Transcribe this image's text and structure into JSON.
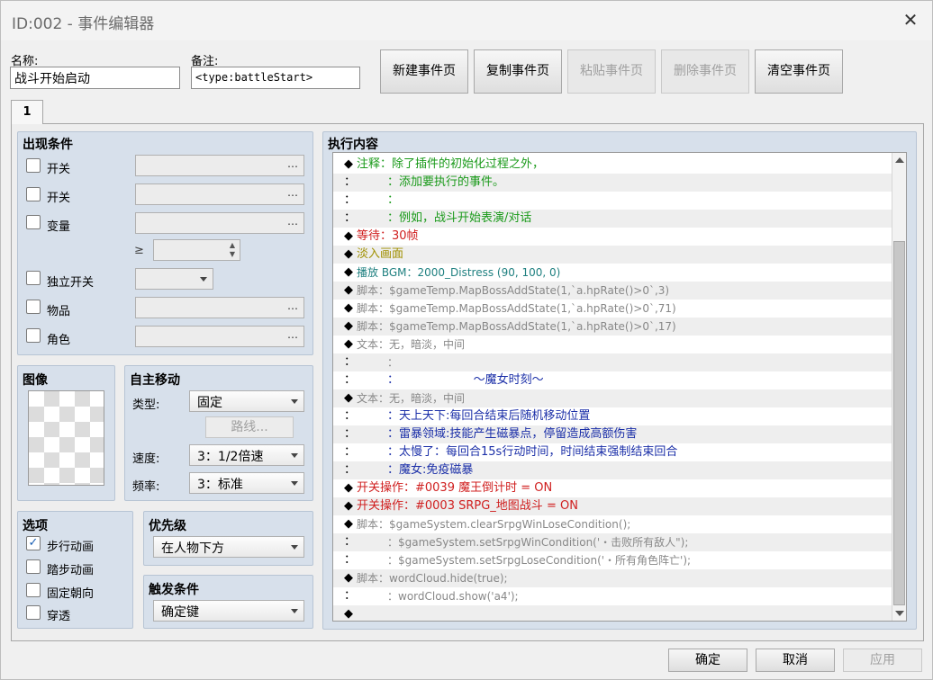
{
  "window": {
    "title": "ID:002 - 事件编辑器"
  },
  "name_label": "名称:",
  "name_value": "战斗开始启动",
  "note_label": "备注:",
  "note_value": "<type:battleStart>",
  "page_buttons": [
    "新建事件页",
    "复制事件页",
    "粘贴事件页",
    "删除事件页",
    "清空事件页"
  ],
  "tab_label": "1",
  "conditions": {
    "title": "出现条件",
    "items": [
      "开关",
      "开关",
      "变量",
      "独立开关",
      "物品",
      "角色"
    ],
    "dots": "…",
    "gte": "≥"
  },
  "image": {
    "title": "图像"
  },
  "autonomous": {
    "title": "自主移动",
    "type_label": "类型:",
    "type_value": "固定",
    "route_button": "路线...",
    "speed_label": "速度:",
    "speed_value": "3：1/2倍速",
    "freq_label": "频率:",
    "freq_value": "3：标准"
  },
  "options": {
    "title": "选项",
    "items": [
      {
        "label": "步行动画",
        "checked": true
      },
      {
        "label": "踏步动画",
        "checked": false
      },
      {
        "label": "固定朝向",
        "checked": false
      },
      {
        "label": "穿透",
        "checked": false
      }
    ],
    "check_mark": "✓"
  },
  "priority": {
    "title": "优先级",
    "value": "在人物下方"
  },
  "trigger": {
    "title": "触发条件",
    "value": "确定键"
  },
  "content": {
    "title": "执行内容",
    "rows": [
      {
        "m": "◆",
        "t": "注释：除了插件的初始化过程之外，",
        "c": "green"
      },
      {
        "m": "：",
        "t": "：添加要执行的事件。",
        "c": "green",
        "i": true
      },
      {
        "m": "：",
        "t": "：",
        "c": "green",
        "i": true
      },
      {
        "m": "：",
        "t": "：例如，战斗开始表演/对话",
        "c": "green",
        "i": true
      },
      {
        "m": "◆",
        "t": "等待：30帧",
        "c": "red"
      },
      {
        "m": "◆",
        "t": "淡入画面",
        "c": "olive"
      },
      {
        "m": "◆",
        "t": "播放 BGM：2000_Distress (90, 100, 0)",
        "c": "teal"
      },
      {
        "m": "◆",
        "t": "脚本：$gameTemp.MapBossAddState(1,`a.hpRate()>0`,3)",
        "c": "gray"
      },
      {
        "m": "◆",
        "t": "脚本：$gameTemp.MapBossAddState(1,`a.hpRate()>0`,71)",
        "c": "gray"
      },
      {
        "m": "◆",
        "t": "脚本：$gameTemp.MapBossAddState(1,`a.hpRate()>0`,17)",
        "c": "gray"
      },
      {
        "m": "◆",
        "t": "文本：无，暗淡，中间",
        "c": "gray"
      },
      {
        "m": "：",
        "t": "：",
        "c": "gray",
        "i": true
      },
      {
        "m": "：",
        "t": "：                    ～魔女时刻～",
        "c": "blue",
        "i": true
      },
      {
        "m": "◆",
        "t": "文本：无，暗淡，中间",
        "c": "gray"
      },
      {
        "m": "：",
        "t": "：天上天下:每回合结束后随机移动位置",
        "c": "blue",
        "i": true
      },
      {
        "m": "：",
        "t": "：雷暴领域:技能产生磁暴点，停留造成高额伤害",
        "c": "blue",
        "i": true
      },
      {
        "m": "：",
        "t": "：太慢了：每回合15s行动时间，时间结束强制结束回合",
        "c": "blue",
        "i": true
      },
      {
        "m": "：",
        "t": "：魔女:免疫磁暴",
        "c": "blue",
        "i": true
      },
      {
        "m": "◆",
        "t": "开关操作：#0039 魔王倒计时 = ON",
        "c": "red"
      },
      {
        "m": "◆",
        "t": "开关操作：#0003 SRPG_地图战斗 = ON",
        "c": "red"
      },
      {
        "m": "◆",
        "t": "脚本：$gameSystem.clearSrpgWinLoseCondition();",
        "c": "gray"
      },
      {
        "m": "：",
        "t": "：$gameSystem.setSrpgWinCondition('・击败所有敌人\");",
        "c": "gray",
        "i": true
      },
      {
        "m": "：",
        "t": "：$gameSystem.setSrpgLoseCondition('・所有角色阵亡');",
        "c": "gray",
        "i": true
      },
      {
        "m": "◆",
        "t": "脚本：wordCloud.hide(true);",
        "c": "gray"
      },
      {
        "m": "：",
        "t": "：wordCloud.show('a4');",
        "c": "gray",
        "i": true
      },
      {
        "m": "◆",
        "t": "",
        "c": "dark"
      }
    ]
  },
  "footer": {
    "ok": "确定",
    "cancel": "取消",
    "apply": "应用"
  }
}
